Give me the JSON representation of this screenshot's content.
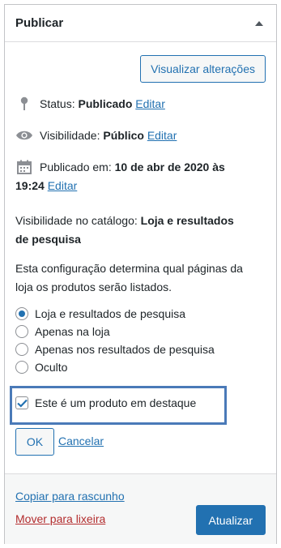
{
  "header": {
    "title": "Publicar",
    "toggle_icon": "triangle-up-icon"
  },
  "preview_button": "Visualizar alterações",
  "status": {
    "label": "Status:",
    "value": "Publicado",
    "edit": "Editar"
  },
  "visibility": {
    "label": "Visibilidade:",
    "value": "Público",
    "edit": "Editar"
  },
  "published": {
    "label": "Publicado em:",
    "value_line1": "10 de abr de 2020 às",
    "value_line2": "19:24",
    "edit": "Editar"
  },
  "catalog": {
    "label": "Visibilidade no catálogo:",
    "value_line1": "Loja e resultados",
    "value_line2": "de pesquisa"
  },
  "description": {
    "line1": "Esta configuração determina qual páginas da",
    "line2": "loja os produtos serão listados."
  },
  "options": [
    {
      "label": "Loja e resultados de pesquisa",
      "checked": true
    },
    {
      "label": "Apenas na loja",
      "checked": false
    },
    {
      "label": "Apenas nos resultados de pesquisa",
      "checked": false
    },
    {
      "label": "Oculto",
      "checked": false
    }
  ],
  "featured": {
    "label": "Este é um produto em destaque",
    "checked": true
  },
  "ok_button": "OK",
  "cancel_link": "Cancelar",
  "footer": {
    "copy_draft": "Copiar para rascunho",
    "move_trash": "Mover para lixeira",
    "update_button": "Atualizar"
  },
  "colors": {
    "accent": "#2271b1",
    "danger": "#b32d2e",
    "highlight": "#4a7ab8"
  }
}
